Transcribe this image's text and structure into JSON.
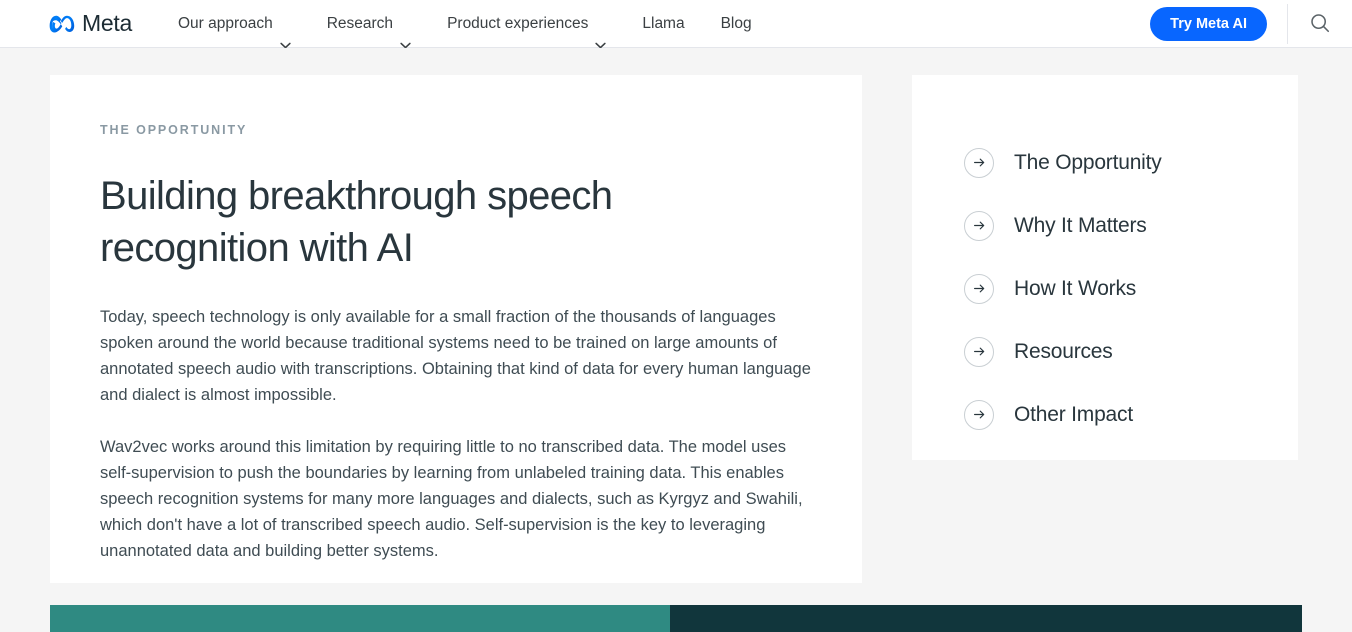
{
  "header": {
    "brand_name": "Meta",
    "brand_logo_icon": "meta-infinity-logo",
    "nav_items": [
      {
        "label": "Our approach",
        "has_dropdown": true,
        "icon": "chevron-down-icon"
      },
      {
        "label": "Research",
        "has_dropdown": true,
        "icon": "chevron-down-icon"
      },
      {
        "label": "Product experiences",
        "has_dropdown": true,
        "icon": "chevron-down-icon"
      },
      {
        "label": "Llama",
        "has_dropdown": false,
        "icon": ""
      },
      {
        "label": "Blog",
        "has_dropdown": false,
        "icon": ""
      }
    ],
    "cta_label": "Try Meta AI",
    "cta_color": "#0866ff",
    "search_icon": "search-icon"
  },
  "main": {
    "eyebrow": "THE OPPORTUNITY",
    "headline": "Building breakthrough speech recognition with AI",
    "paragraphs": [
      "Today, speech technology is only available for a small fraction of the thousands of languages spoken around the world because traditional systems need to be trained on large amounts of annotated speech audio with transcriptions. Obtaining that kind of data for every human language and dialect is almost impossible.",
      "Wav2vec works around this limitation by requiring little to no transcribed data. The model uses self-supervision to push the boundaries by learning from unlabeled training data. This enables speech recognition systems for many more languages and dialects, such as Kyrgyz and Swahili, which don't have a lot of transcribed speech audio. Self-supervision is the key to leveraging unannotated data and building better systems."
    ]
  },
  "sidebar": {
    "items": [
      {
        "label": "The Opportunity",
        "icon": "arrow-right-circle-icon"
      },
      {
        "label": "Why It Matters",
        "icon": "arrow-right-circle-icon"
      },
      {
        "label": "How It Works",
        "icon": "arrow-right-circle-icon"
      },
      {
        "label": "Resources",
        "icon": "arrow-right-circle-icon"
      },
      {
        "label": "Other Impact",
        "icon": "arrow-right-circle-icon"
      }
    ]
  },
  "bottom_bands": {
    "left_color": "#2f8a82",
    "right_color": "#11363c"
  }
}
